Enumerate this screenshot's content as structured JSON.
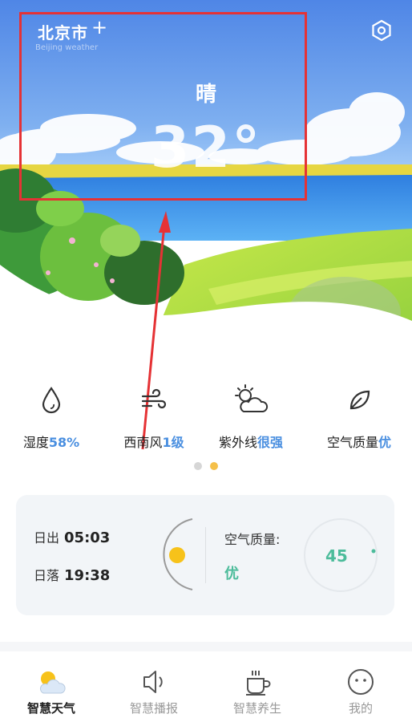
{
  "header": {
    "city": "北京市",
    "add_icon": "plus-icon",
    "subtitle": "Beijing weather",
    "settings_icon": "hexagon-settings-icon"
  },
  "current": {
    "condition": "晴",
    "temperature": "32°"
  },
  "stats": [
    {
      "icon": "droplet-icon",
      "label": "湿度",
      "value": "58%"
    },
    {
      "icon": "wind-icon",
      "label": "西南风",
      "value": "1级"
    },
    {
      "icon": "sun-cloud-icon",
      "label": "紫外线",
      "value": "很强"
    },
    {
      "icon": "leaf-icon",
      "label": "空气质量",
      "value": "优"
    }
  ],
  "pager": {
    "page_count": 2,
    "active_index": 1
  },
  "sun": {
    "sunrise_label": "日出",
    "sunrise_time": "05:03",
    "sunset_label": "日落",
    "sunset_time": "19:38"
  },
  "air": {
    "label": "空气质量:",
    "level": "优",
    "value": "45"
  },
  "nav": [
    {
      "icon": "weather-icon",
      "label": "智慧天气",
      "active": true
    },
    {
      "icon": "speaker-icon",
      "label": "智慧播报",
      "active": false
    },
    {
      "icon": "tea-cup-icon",
      "label": "智慧养生",
      "active": false
    },
    {
      "icon": "smiley-icon",
      "label": "我的",
      "active": false
    }
  ],
  "colors": {
    "accent_blue": "#4a8fe0",
    "air_green": "#4dbc9b",
    "sun_yellow": "#f7c21a",
    "highlight_red": "#e53235"
  }
}
